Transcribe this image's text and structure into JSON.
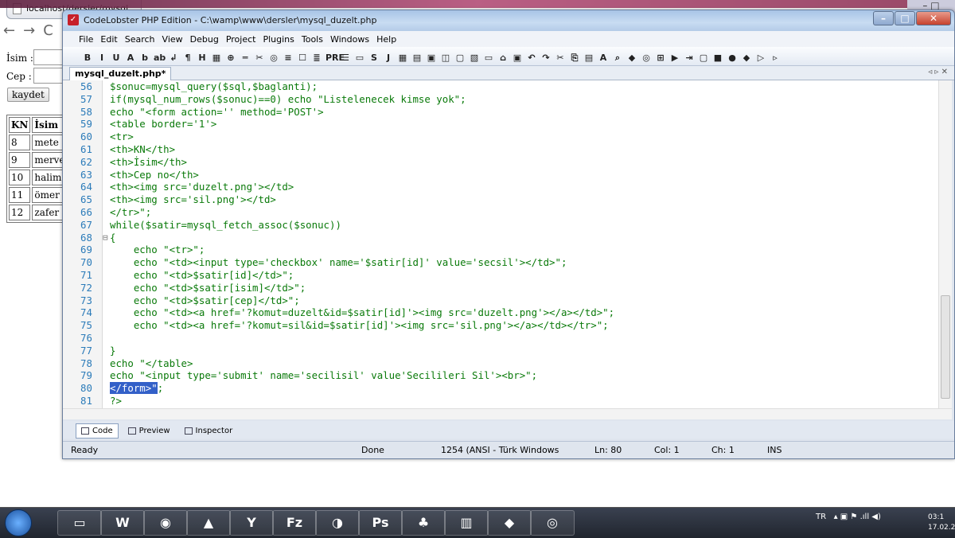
{
  "browser": {
    "tab_title": "localhost/dersler/mysql",
    "nav_back": "←",
    "nav_forward": "→",
    "nav_reload": "C",
    "form": {
      "isim_label": "İsim :",
      "cep_label": "Cep :",
      "button": "kaydet"
    },
    "table": {
      "headers": [
        "KN",
        "İsim"
      ],
      "rows": [
        [
          "8",
          "mete"
        ],
        [
          "9",
          "merve"
        ],
        [
          "10",
          "halime"
        ],
        [
          "11",
          "ömer"
        ],
        [
          "12",
          "zafer"
        ]
      ]
    }
  },
  "window": {
    "title": "CodeLobster PHP Edition - C:\\wamp\\www\\dersler\\mysql_duzelt.php",
    "minimize": "–",
    "maximize": "□",
    "close": "✕",
    "corner": "– □"
  },
  "menu": [
    "File",
    "Edit",
    "Search",
    "View",
    "Debug",
    "Project",
    "Plugins",
    "Tools",
    "Windows",
    "Help"
  ],
  "toolbar_glyphs": [
    "B",
    "I",
    "U",
    "A",
    "b",
    "ab",
    "↲",
    "¶",
    "H",
    "▦",
    "⊕",
    "═",
    "✂",
    "◎",
    "≡",
    "☐",
    "≣",
    "PRE",
    "☰",
    "▭",
    "S",
    "J",
    "▦",
    "▤",
    "▣",
    "◫",
    "▢",
    "▧",
    "▭",
    "⌂",
    "▣",
    "↶",
    "↷",
    "✂",
    "⎘",
    "▤",
    "A",
    "⌕",
    "◆",
    "◎",
    "⊞",
    "▶",
    "⇥",
    "▢",
    "■",
    "●",
    "◆",
    "▷",
    "▹"
  ],
  "file_tab": "mysql_duzelt.php*",
  "file_nav": "◃ ▹ ✕",
  "code_lines": [
    {
      "num": "56",
      "text": "$sonuc=mysql_query($sql,$baglanti);"
    },
    {
      "num": "57",
      "text": "if(mysql_num_rows($sonuc)==0) echo \"Listelenecek kimse yok\";"
    },
    {
      "num": "58",
      "text": "echo \"<form action='' method='POST'>"
    },
    {
      "num": "59",
      "text": "<table border='1'>"
    },
    {
      "num": "60",
      "text": "<tr>"
    },
    {
      "num": "61",
      "text": "<th>KN</th>"
    },
    {
      "num": "62",
      "text": "<th>İsim</th>"
    },
    {
      "num": "63",
      "text": "<th>Cep no</th>"
    },
    {
      "num": "64",
      "text": "<th><img src='duzelt.png'></td>"
    },
    {
      "num": "65",
      "text": "<th><img src='sil.png'></td>"
    },
    {
      "num": "66",
      "text": "</tr>\";"
    },
    {
      "num": "67",
      "text": "while($satir=mysql_fetch_assoc($sonuc))"
    },
    {
      "num": "68",
      "text": "{"
    },
    {
      "num": "69",
      "text": "    echo \"<tr>\";"
    },
    {
      "num": "70",
      "text": "    echo \"<td><input type='checkbox' name='$satir[id]' value='secsil'></td>\";"
    },
    {
      "num": "71",
      "text": "    echo \"<td>$satir[id]</td>\";"
    },
    {
      "num": "72",
      "text": "    echo \"<td>$satir[isim]</td>\";"
    },
    {
      "num": "73",
      "text": "    echo \"<td>$satir[cep]</td>\";"
    },
    {
      "num": "74",
      "text": "    echo \"<td><a href='?komut=duzelt&id=$satir[id]'><img src='duzelt.png'></a></td>\";"
    },
    {
      "num": "75",
      "text": "    echo \"<td><a href='?komut=sil&id=$satir[id]'><img src='sil.png'></a></td></tr>\";"
    },
    {
      "num": "76",
      "text": ""
    },
    {
      "num": "77",
      "text": "}"
    },
    {
      "num": "78",
      "text": "echo \"</table>"
    },
    {
      "num": "79",
      "text": "echo \"<input type='submit' name='secilisil' value'Secilileri Sil'><br>\";"
    },
    {
      "num": "80",
      "text": "</form>\";"
    },
    {
      "num": "81",
      "text": "?>"
    }
  ],
  "view_tabs": [
    "Code",
    "Preview",
    "Inspector"
  ],
  "status": {
    "ready": "Ready",
    "done": "Done",
    "encoding": "1254 (ANSI - Türk Windows",
    "ln": "Ln: 80",
    "col": "Col: 1",
    "ch": "Ch: 1",
    "ins": "INS"
  },
  "taskbar": {
    "apps": [
      "▭",
      "W",
      "◉",
      "▲",
      "Y",
      "Fz",
      "◑",
      "Ps",
      "♣",
      "▥",
      "◆",
      "◎"
    ],
    "lang": "TR",
    "tray_icons": "▴ ▣ ⚑ .ıll ◀)",
    "time": "03:1",
    "date": "17.02.2"
  }
}
